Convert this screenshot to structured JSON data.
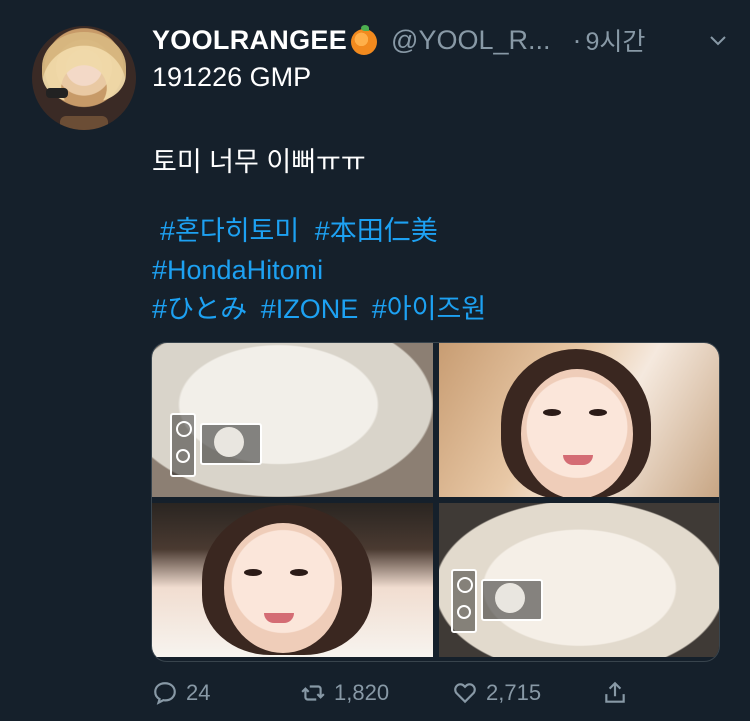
{
  "tweet": {
    "author_name": "YOOLRANGEE",
    "author_emoji": "orange-emoji",
    "handle": "@YOOL_R...",
    "separator": "·",
    "time": "9시간",
    "line1": "191226 GMP",
    "line2": "토미 너무 이뻐ㅠㅠ",
    "hashtags": {
      "row1": [
        "#혼다히토미",
        "#本田仁美"
      ],
      "row2": [
        "#HondaHitomi"
      ],
      "row3": [
        "#ひとみ",
        "#IZONE",
        "#아이즈원"
      ]
    }
  },
  "actions": {
    "reply_count": "24",
    "retweet_count": "1,820",
    "like_count": "2,715"
  },
  "colors": {
    "background": "#15202b",
    "accent": "#1da1f2",
    "muted": "#8899a6"
  }
}
